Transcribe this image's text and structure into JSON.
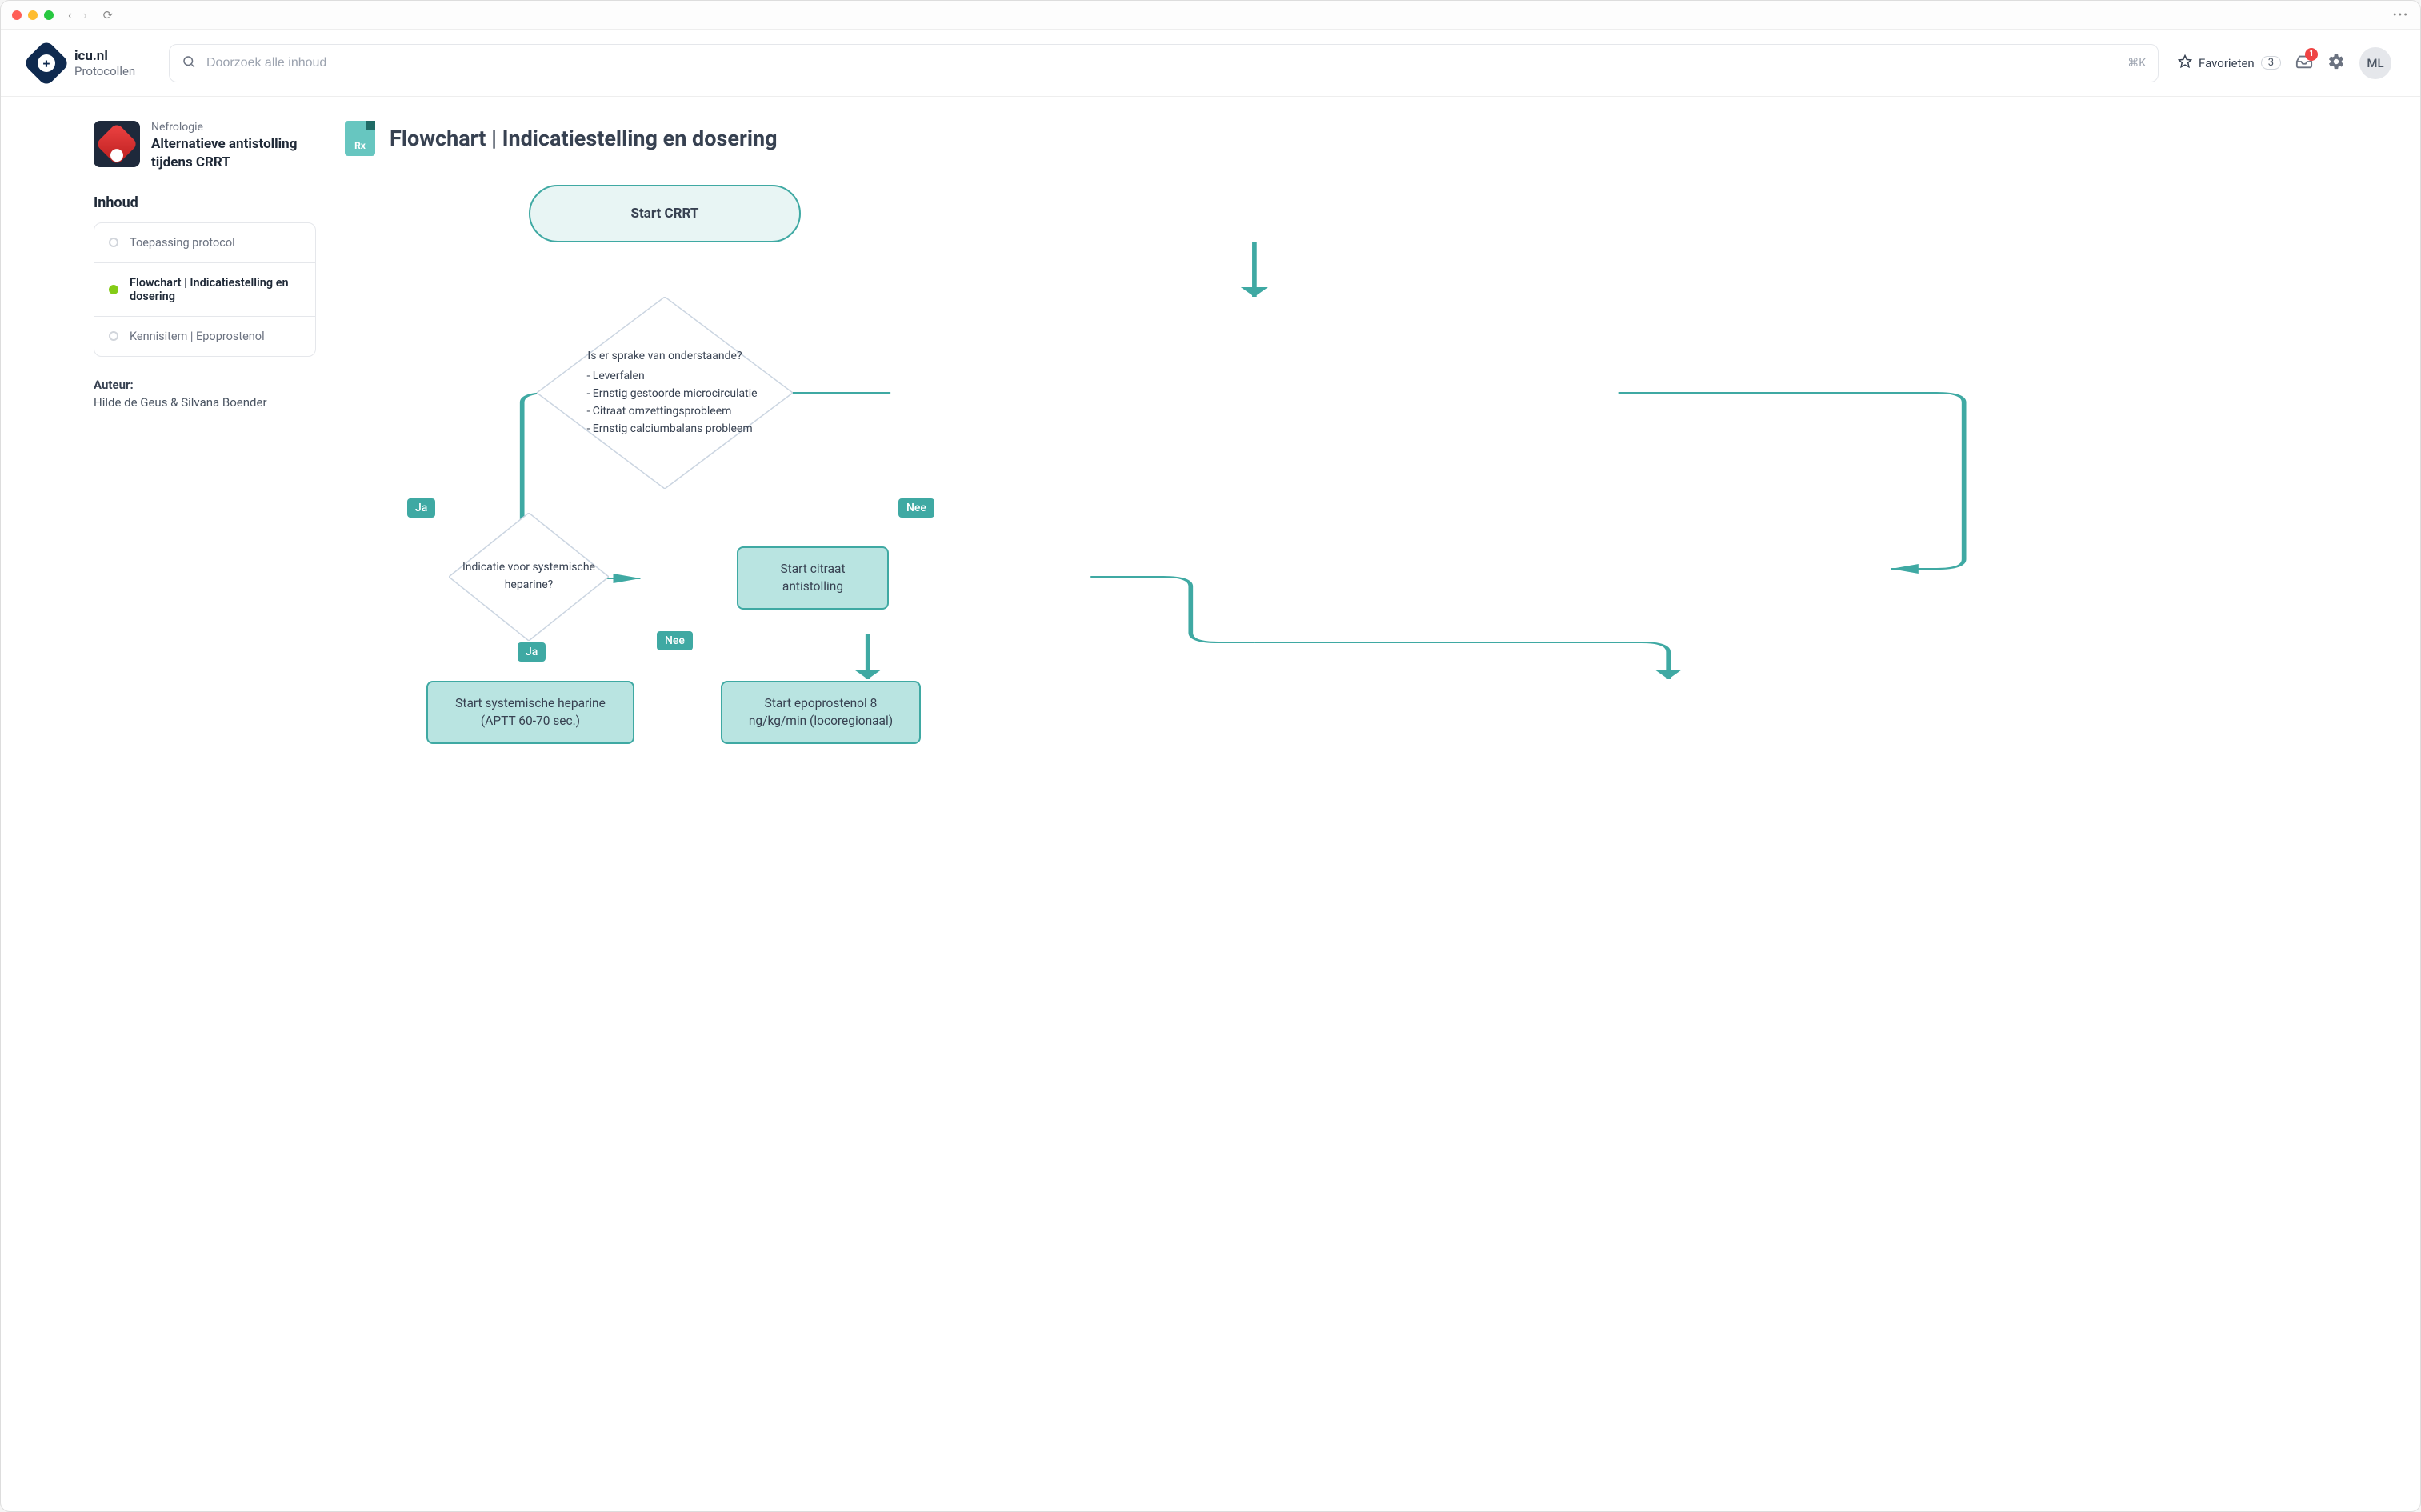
{
  "browser": {
    "dots": "•••"
  },
  "app": {
    "name": "icu.nl",
    "section": "Protocollen"
  },
  "search": {
    "placeholder": "Doorzoek alle inhoud",
    "shortcut": "⌘K"
  },
  "header": {
    "favorites_label": "Favorieten",
    "favorites_count": "3",
    "inbox_badge": "1",
    "avatar_initials": "ML"
  },
  "protocol": {
    "category": "Nefrologie",
    "title": "Alternatieve antistolling tijdens CRRT"
  },
  "sidebar": {
    "contents_heading": "Inhoud",
    "toc": [
      {
        "label": "Toepassing protocol",
        "active": false
      },
      {
        "label": "Flowchart | Indicatiestelling en dosering",
        "active": true
      },
      {
        "label": "Kennisitem | Epoprostenol",
        "active": false
      }
    ],
    "author_label": "Auteur:",
    "author_value": "Hilde de Geus & Silvana Boender"
  },
  "content": {
    "icon_label": "Rx",
    "title": "Flowchart | Indicatiestelling en dosering"
  },
  "flowchart": {
    "start": "Start CRRT",
    "decision1": {
      "question": "Is er sprake van onderstaande?",
      "items": [
        "Leverfalen",
        "Ernstig gestoorde microcirculatie",
        "Citraat omzettingsprobleem",
        "Ernstig calciumbalans probleem"
      ]
    },
    "label_yes": "Ja",
    "label_no": "Nee",
    "decision2": "Indicatie voor systemische heparine?",
    "action_citraat": "Start citraat antistolling",
    "action_heparine": "Start systemische heparine (APTT 60-70 sec.)",
    "action_epoprostenol": "Start epoprostenol 8 ng/kg/min (locoregionaal)"
  }
}
